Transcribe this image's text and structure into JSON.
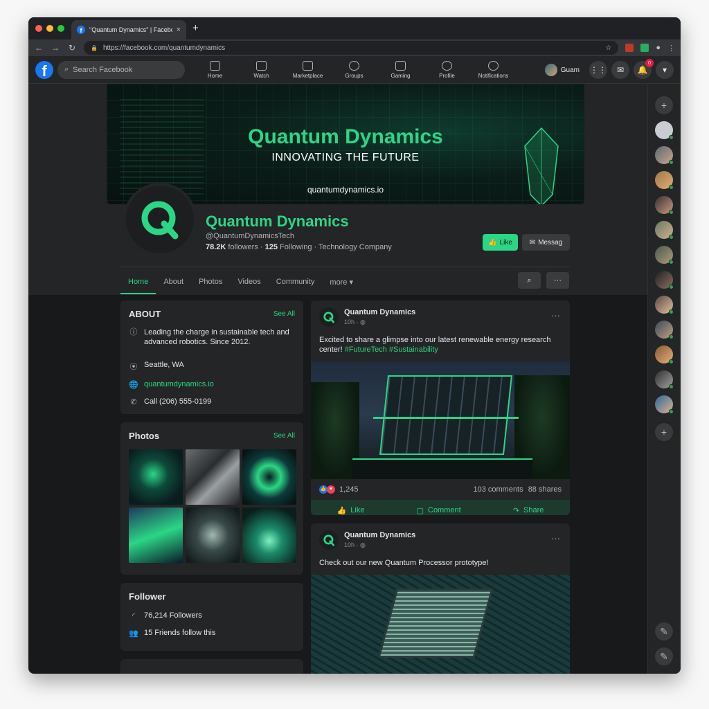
{
  "browser": {
    "tab_title": "\"Quantum Dynamics\" | Faceboo",
    "tab_close": "×",
    "new_tab": "+",
    "url": "https://facebook.com/quantumdynamics"
  },
  "fb": {
    "logo": "f",
    "search_placeholder": "Search Facebook",
    "nav": [
      {
        "label": "Home",
        "icon": "home-icon"
      },
      {
        "label": "Watch",
        "icon": "watch-icon"
      },
      {
        "label": "Marketplace",
        "icon": "marketplace-icon"
      },
      {
        "label": "Groups",
        "icon": "groups-icon"
      },
      {
        "label": "Gaming",
        "icon": "gaming-icon"
      },
      {
        "label": "Profile",
        "icon": "profile-icon"
      },
      {
        "label": "Notifications",
        "icon": "bell-icon"
      }
    ],
    "user_name": "Guam",
    "notif_count": "0"
  },
  "page": {
    "cover_title": "Quantum Dynamics",
    "cover_subtitle": "INNOVATING THE FUTURE",
    "cover_url": "quantumdynamics.io",
    "name": "Quantum Dynamics",
    "handle": "@QuantumDynamicsTech",
    "followers": "78.2K",
    "followers_label": "followers ·",
    "following": "125",
    "following_label": "Following · Technology Company",
    "like_label": "Like",
    "message_label": "Messag",
    "tabs": [
      "Home",
      "About",
      "Photos",
      "Videos",
      "Community",
      "more ▾"
    ]
  },
  "about": {
    "title": "ABOUT",
    "see_all": "See All",
    "description": "Leading the charge in sustainable tech and advanced robotics. Since 2012.",
    "location": "Seattle, WA",
    "website": "quantumdynamics.io",
    "phone": "Call (206) 555-0199"
  },
  "photos": {
    "title": "Photos",
    "see_all": "See All"
  },
  "follower": {
    "title": "Follower",
    "count": "76,214 Followers",
    "friends": "15 Friends follow this"
  },
  "posts": [
    {
      "author": "Quantum Dynamics",
      "time": "10h · ",
      "text": "Excited to share a glimpse into our latest renewable energy research center!",
      "tags": "#FutureTech #Sustainability",
      "reactions": "1,245",
      "comments": "103 comments",
      "shares": "88 shares",
      "like": "Like",
      "comment": "Comment",
      "share": "Share"
    },
    {
      "author": "Quantum Dynamics",
      "time": "10h · ",
      "text": "Check out our new Quantum Processor prototype!"
    }
  ],
  "colors": {
    "accent": "#2bd686",
    "bg": "#18191a",
    "card": "#242526",
    "fb_blue": "#1877f2"
  }
}
